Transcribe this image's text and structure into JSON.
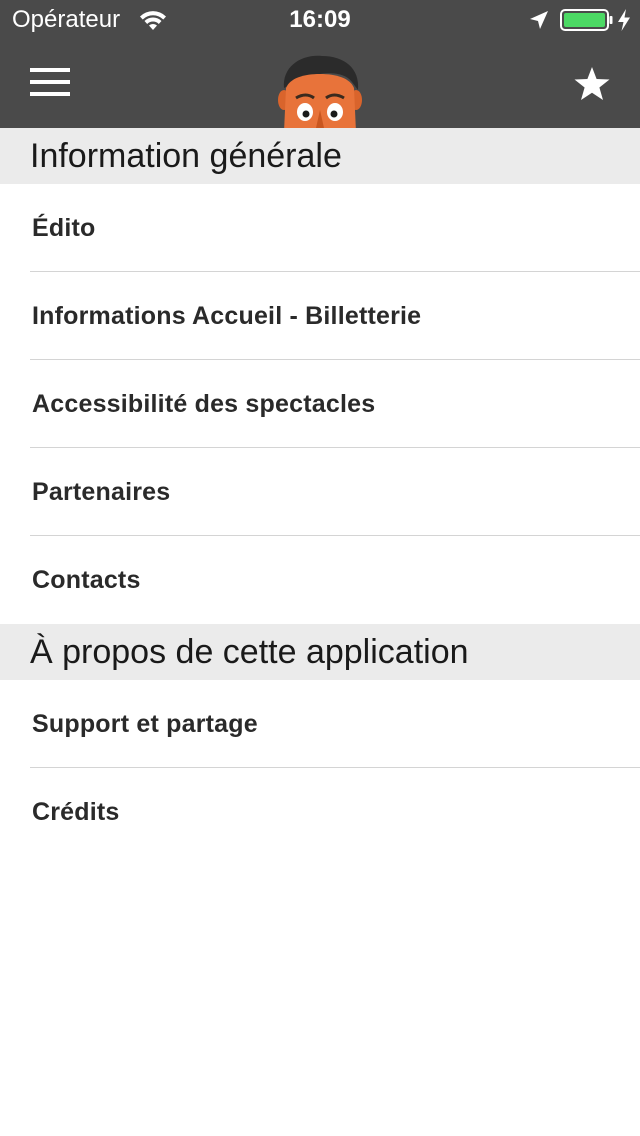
{
  "status_bar": {
    "carrier": "Opérateur",
    "time": "16:09",
    "battery_color": "#4cd964"
  },
  "nav": {
    "menu_icon": "hamburger-menu-icon",
    "logo": "cartoon-face-logo",
    "favorite_icon": "star-icon"
  },
  "sections": [
    {
      "title": "Information générale",
      "items": [
        {
          "label": "Édito"
        },
        {
          "label": "Informations Accueil - Billetterie"
        },
        {
          "label": "Accessibilité des spectacles"
        },
        {
          "label": "Partenaires"
        },
        {
          "label": "Contacts"
        }
      ]
    },
    {
      "title": "À propos de cette application",
      "items": [
        {
          "label": "Support et partage"
        },
        {
          "label": "Crédits"
        }
      ]
    }
  ],
  "colors": {
    "bar_background": "#4a4a4a",
    "section_background": "#ebebeb",
    "separator": "#d4d4d4"
  }
}
